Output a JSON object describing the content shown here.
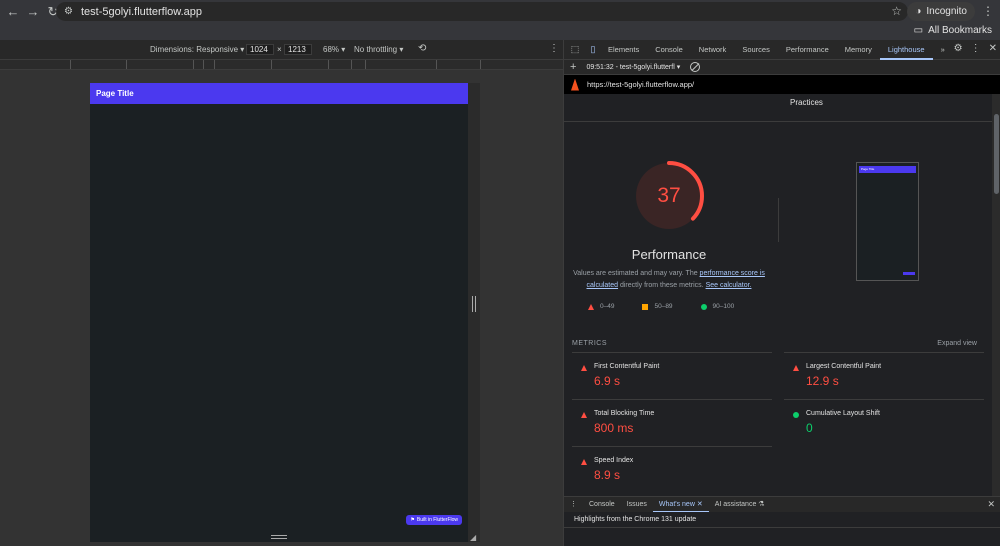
{
  "browser": {
    "url": "test-5golyi.flutterflow.app",
    "profile_label": "Incognito",
    "bookmarks_label": "All Bookmarks"
  },
  "device_toolbar": {
    "dimensions_label": "Dimensions: Responsive",
    "width": "1024",
    "times": "×",
    "height": "1213",
    "zoom": "68%",
    "throttling": "No throttling"
  },
  "page": {
    "title": "Page Title",
    "built_in_label": "Built in FlutterFlow",
    "appbar_color": "#4b39ef"
  },
  "devtools": {
    "tabs": [
      "Elements",
      "Console",
      "Network",
      "Sources",
      "Performance",
      "Memory",
      "Lighthouse"
    ],
    "active_tab": "Lighthouse",
    "report_label": "09:51:32 - test-5golyi.flutterfl",
    "report_url": "https://test-5golyi.flutterflow.app/"
  },
  "lighthouse": {
    "practices_label": "Practices",
    "score": "37",
    "score_fraction": 0.37,
    "score_color": "#ff4e42",
    "category_title": "Performance",
    "desc_prefix": "Values are estimated and may vary. The ",
    "desc_link1": "performance score is calculated",
    "desc_middle": " directly from these metrics. ",
    "desc_link2": "See calculator.",
    "legend": [
      {
        "range": "0–49",
        "shape": "triangle",
        "color": "#ff4e42"
      },
      {
        "range": "50–89",
        "shape": "square",
        "color": "#ffa400"
      },
      {
        "range": "90–100",
        "shape": "circle",
        "color": "#0cce6b"
      }
    ],
    "thumbnail_title": "Page Title",
    "metrics_heading": "METRICS",
    "expand_label": "Expand view",
    "metrics": [
      {
        "label": "First Contentful Paint",
        "value": "6.9 s",
        "status": "fail"
      },
      {
        "label": "Largest Contentful Paint",
        "value": "12.9 s",
        "status": "fail"
      },
      {
        "label": "Total Blocking Time",
        "value": "800 ms",
        "status": "fail"
      },
      {
        "label": "Cumulative Layout Shift",
        "value": "0",
        "status": "pass"
      },
      {
        "label": "Speed Index",
        "value": "8.9 s",
        "status": "fail"
      }
    ]
  },
  "drawer": {
    "tabs": [
      "Console",
      "Issues",
      "What's new",
      "AI assistance"
    ],
    "active_tab": "What's new",
    "highlight": "Highlights from the Chrome 131 update"
  }
}
